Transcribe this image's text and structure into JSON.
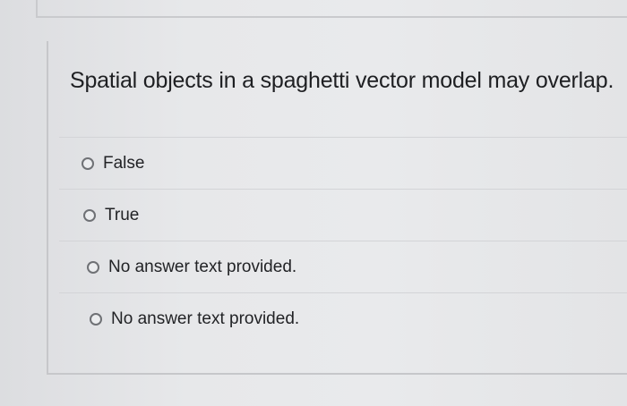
{
  "question": {
    "text": "Spatial objects in a spaghetti vector model may overlap."
  },
  "options": [
    {
      "label": "False",
      "selected": false
    },
    {
      "label": "True",
      "selected": false
    },
    {
      "label": "No answer text provided.",
      "selected": false
    },
    {
      "label": "No answer text provided.",
      "selected": false
    }
  ]
}
